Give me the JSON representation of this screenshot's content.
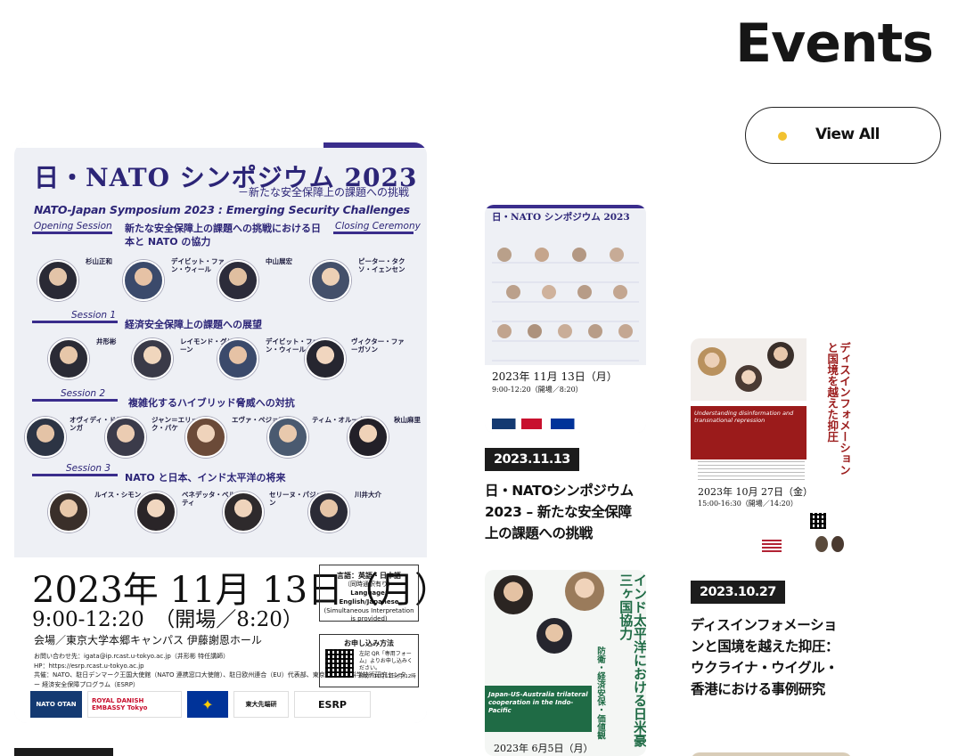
{
  "header": {
    "title": "Events",
    "view_all_label": "View All"
  },
  "featured": {
    "poster": {
      "title_ja": "日・NATO シンポジウム 2023",
      "subtitle_ja": "－新たな安全保障上の課題への挑戦",
      "title_en": "NATO-Japan Symposium 2023 : Emerging Security Challenges",
      "opening": "Opening Session",
      "closing": "Closing Ceremony",
      "opening_title": "新たな安全保障上の課題への挑戦における日本と NATO の協力",
      "s1": "Session 1",
      "s1_title": "経済安全保障上の課題への展望",
      "s2": "Session 2",
      "s2_title": "複雑化するハイブリッド脅威への対抗",
      "s3": "Session 3",
      "s3_title": "NATO と日本、インド太平洋の将来",
      "speakers_row1": [
        "杉山正和",
        "デイビット・ファン・ウィール",
        "中山展宏",
        "ピーター・タクソ・イェンセン"
      ],
      "speakers_row2": [
        "井形彬",
        "レイモンド・グリーン",
        "デイビット・ファン・ウィール",
        "ヴィクター・ファーガソン"
      ],
      "speakers_row3": [
        "オヴィディ・ドランガ",
        "ジャン＝エリック・パケ",
        "エヴァ・ペジョワ",
        "ティム・オルーク",
        "秋山麻里"
      ],
      "speakers_row4": [
        "ルイス・シモン",
        "ベネデッタ・ベルティ",
        "セリーヌ・パジョン",
        "川井大介"
      ],
      "date": "2023年 11月 13日（月）",
      "time": "9:00-12:20　（開場／8:20）",
      "venue": "会場／東京大学本郷キャンパス 伊藤謝恩ホール",
      "contact_1": "お問い合わせ先：igata@ip.rcast.u-tokyo.ac.jp（井形彬 特任講師）",
      "contact_2": "HP：https://esrp.rcast.u-tokyo.ac.jp",
      "contact_3": "共催：NATO、駐日デンマーク王国大使館（NATO 連携窓口大使館）、駐日欧州連合（EU）代表部、東京大学先端科学技術研究センター 経済安全保障プログラム（ESRP）",
      "lang_title": "言語：英語・日本語",
      "lang_sub": "（同時通訳有り）",
      "lang_en": "Language: English/Japanese",
      "lang_en_sub": "(Simultaneous Interpretation is provided)",
      "apply_title": "お申し込み方法",
      "apply_text": "左記 QR「専用フォーム」よりお申し込みください。",
      "apply_deadline": "締切：11月12日(月)12時",
      "logo_nato": "NATO OTAN",
      "logo_denmark": "ROYAL DANISH EMBASSY Tokyo",
      "logo_rcast": "東大先端研",
      "logo_esrp": "ESRP"
    }
  },
  "events": [
    {
      "date": "2023.11.13",
      "title_lines": [
        "日・NATOシンポジウム",
        "2023 – 新たな安全保障",
        "上の課題への挑戦"
      ],
      "poster_title": "日・NATO シンポジウム 2023",
      "poster_date": "2023年 11月 13日（月）",
      "poster_time": "9:00-12:20（開場／8:20）"
    },
    {
      "date": "2023.10.27",
      "title_lines": [
        "ディスインフォメーショ",
        "ンと国境を越えた抑圧：",
        "ウクライナ・ウイグル・",
        "香港における事例研究"
      ],
      "poster_vertical": "ディスインフォメーションと国境を越えた抑圧",
      "poster_en": "Understanding disinformation and transnational repression",
      "poster_date": "2023年 10月 27日（金）",
      "poster_time": "15:00-16:30（開場／14:20）"
    },
    {
      "poster_vertical": "インド太平洋における日米豪三ヶ国協力",
      "poster_sub": "防衛・経済安保・価値観",
      "poster_en": "Japan-US-Australia trilateral cooperation in the Indo-Pacific",
      "poster_date": "2023年 6月5日（月）"
    }
  ]
}
